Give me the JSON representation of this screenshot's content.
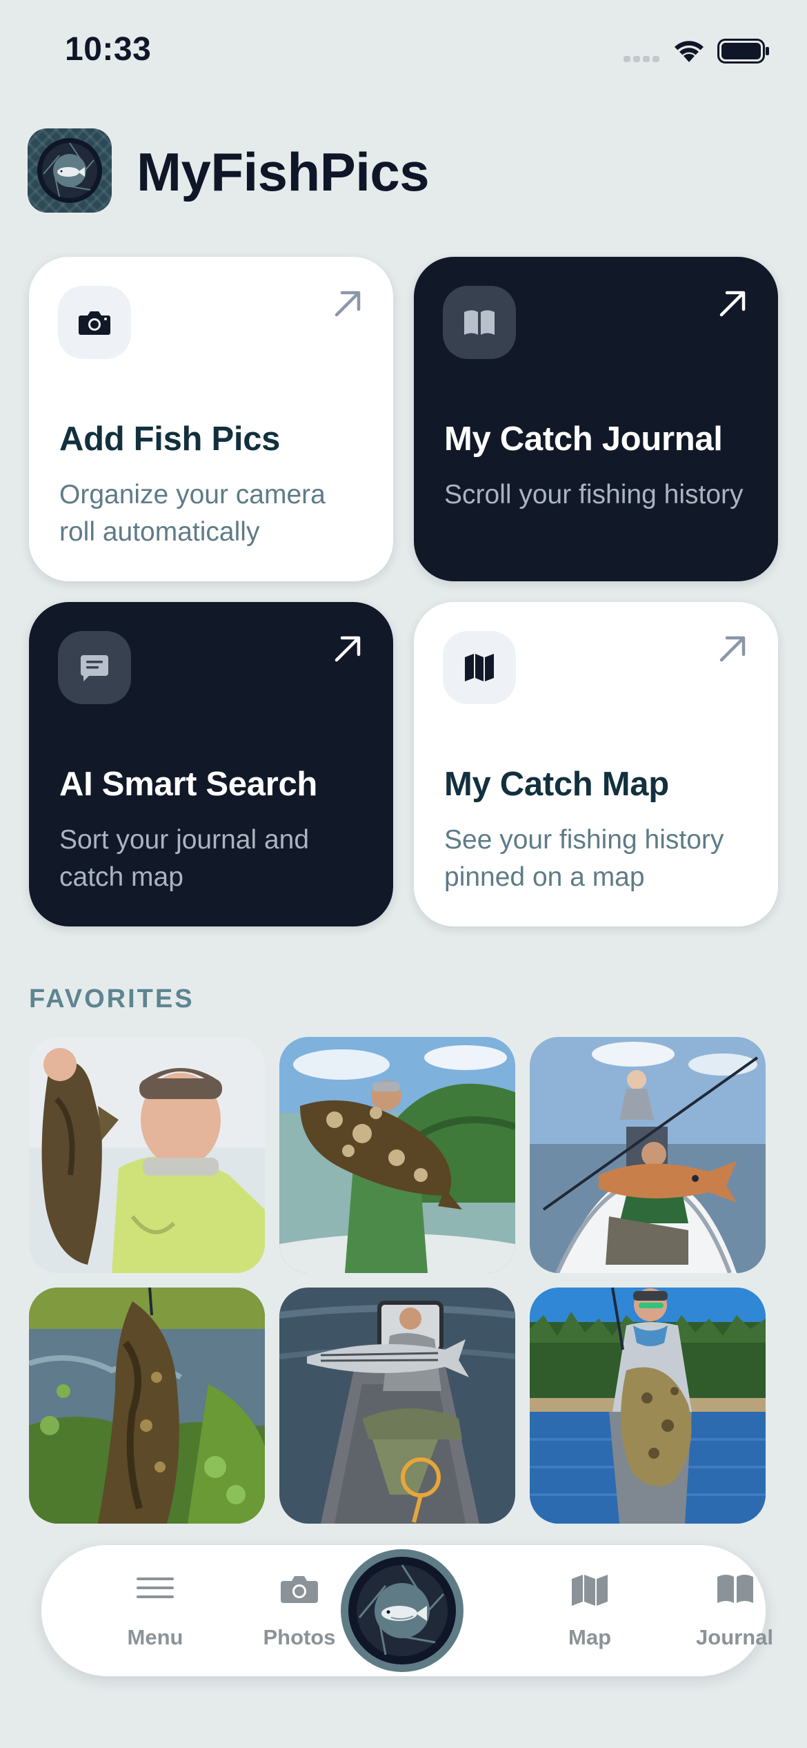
{
  "status_bar": {
    "time": "10:33",
    "icons": [
      "signal-icon",
      "wifi-icon",
      "battery-icon"
    ]
  },
  "app": {
    "title": "MyFishPics",
    "logo_icon": "fish-camera-logo-icon"
  },
  "cards": [
    {
      "title": "Add Fish Pics",
      "subtitle": "Organize your camera roll automatically",
      "icon": "camera-icon",
      "theme": "light"
    },
    {
      "title": "My Catch Journal",
      "subtitle": "Scroll your fishing history",
      "icon": "book-icon",
      "theme": "dark"
    },
    {
      "title": "AI Smart Search",
      "subtitle": "Sort your journal and catch map",
      "icon": "chat-icon",
      "theme": "dark"
    },
    {
      "title": "My Catch Map",
      "subtitle": "See your fishing history pinned on a map",
      "icon": "map-icon",
      "theme": "light"
    }
  ],
  "favorites": {
    "label": "FAVORITES",
    "photos": [
      {
        "name": "favorite-photo-bass"
      },
      {
        "name": "favorite-photo-grouper"
      },
      {
        "name": "favorite-photo-redfish"
      },
      {
        "name": "favorite-photo-snakehead"
      },
      {
        "name": "favorite-photo-striper"
      },
      {
        "name": "favorite-photo-flounder"
      }
    ]
  },
  "tab_bar": {
    "menu": "Menu",
    "photos": "Photos",
    "map": "Map",
    "journal": "Journal",
    "center_icon": "fish-camera-logo-icon"
  },
  "colors": {
    "background": "#e5ebeb",
    "dark_card": "#111827",
    "light_card": "#ffffff",
    "accent_text": "#5e8491"
  }
}
